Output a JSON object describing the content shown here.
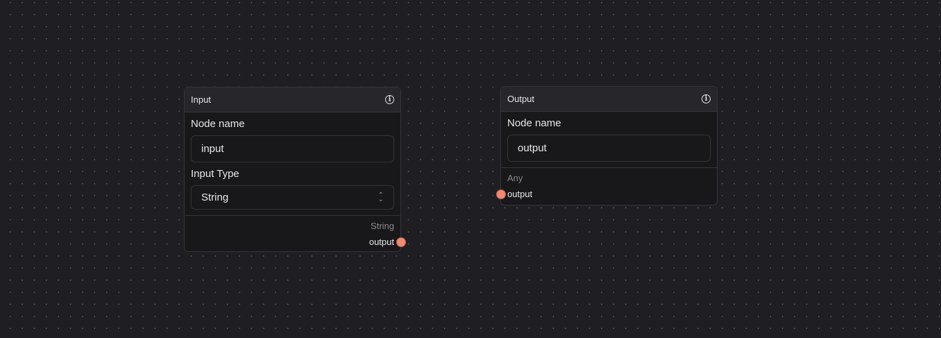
{
  "nodes": {
    "input": {
      "title": "Input",
      "name_label": "Node name",
      "name_value": "input",
      "type_label": "Input Type",
      "type_value": "String",
      "port_type": "String",
      "port_name": "output"
    },
    "output": {
      "title": "Output",
      "name_label": "Node name",
      "name_value": "output",
      "port_type": "Any",
      "port_name": "output"
    }
  },
  "colors": {
    "port": "#f08a72",
    "background": "#1f1f23"
  }
}
